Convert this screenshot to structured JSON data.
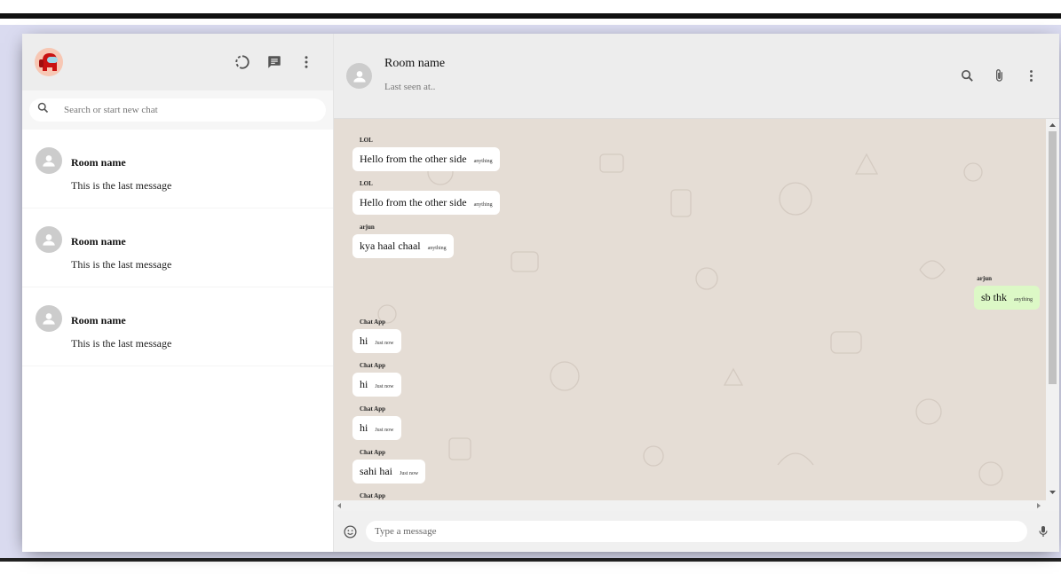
{
  "sidebar": {
    "search": {
      "placeholder": "Search or start new chat"
    },
    "chats": [
      {
        "name": "Room name",
        "last_message": "This is the last message"
      },
      {
        "name": "Room name",
        "last_message": "This is the last message"
      },
      {
        "name": "Room name",
        "last_message": "This is the last message"
      }
    ]
  },
  "chat": {
    "header": {
      "name": "Room name",
      "last_seen": "Last seen at.."
    },
    "messages": [
      {
        "sender": "LOL",
        "text": "Hello from the other side",
        "time": "anything",
        "own": false
      },
      {
        "sender": "LOL",
        "text": "Hello from the other side",
        "time": "anything",
        "own": false
      },
      {
        "sender": "arjun",
        "text": "kya haal chaal",
        "time": "anything",
        "own": false
      },
      {
        "sender": "arjun",
        "text": "sb thk",
        "time": "anything",
        "own": true
      },
      {
        "sender": "Chat App",
        "text": "hi",
        "time": "Just now",
        "own": false
      },
      {
        "sender": "Chat App",
        "text": "hi",
        "time": "Just now",
        "own": false
      },
      {
        "sender": "Chat App",
        "text": "hi",
        "time": "Just now",
        "own": false
      },
      {
        "sender": "Chat App",
        "text": "sahi hai",
        "time": "Just now",
        "own": false
      },
      {
        "sender": "Chat App",
        "text": "",
        "time": "",
        "own": false
      }
    ],
    "footer": {
      "placeholder": "Type a message"
    }
  },
  "colors": {
    "accent_bubble_own": "#dcf8c6",
    "chat_background": "#e5ddd5",
    "header_bg": "#ededed"
  },
  "icons": [
    "status-icon",
    "new-chat-icon",
    "more-vert-icon",
    "search-icon",
    "attach-icon",
    "emoji-icon",
    "mic-icon"
  ]
}
